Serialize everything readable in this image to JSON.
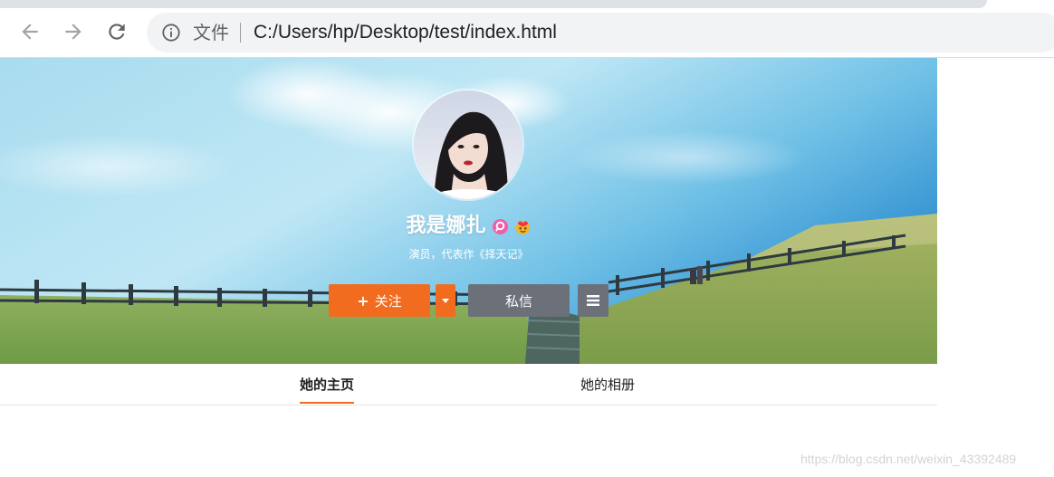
{
  "browser": {
    "scheme_label": "文件",
    "url": "C:/Users/hp/Desktop/test/index.html"
  },
  "profile": {
    "name": "我是娜扎",
    "description": "演员，代表作《择天记》"
  },
  "actions": {
    "follow_plus": "+",
    "follow_label": "关注",
    "message_label": "私信"
  },
  "tabs": [
    {
      "label": "她的主页",
      "active": true
    },
    {
      "label": "她的相册",
      "active": false
    }
  ],
  "watermark": "https://blog.csdn.net/weixin_43392489",
  "colors": {
    "accent": "#f26c1f",
    "secondary_button": "#6c7078"
  },
  "icons": [
    "back-arrow-icon",
    "forward-arrow-icon",
    "reload-icon",
    "info-icon",
    "search-badge-icon",
    "emoji-badge-icon",
    "dropdown-caret-icon",
    "hamburger-menu-icon"
  ]
}
